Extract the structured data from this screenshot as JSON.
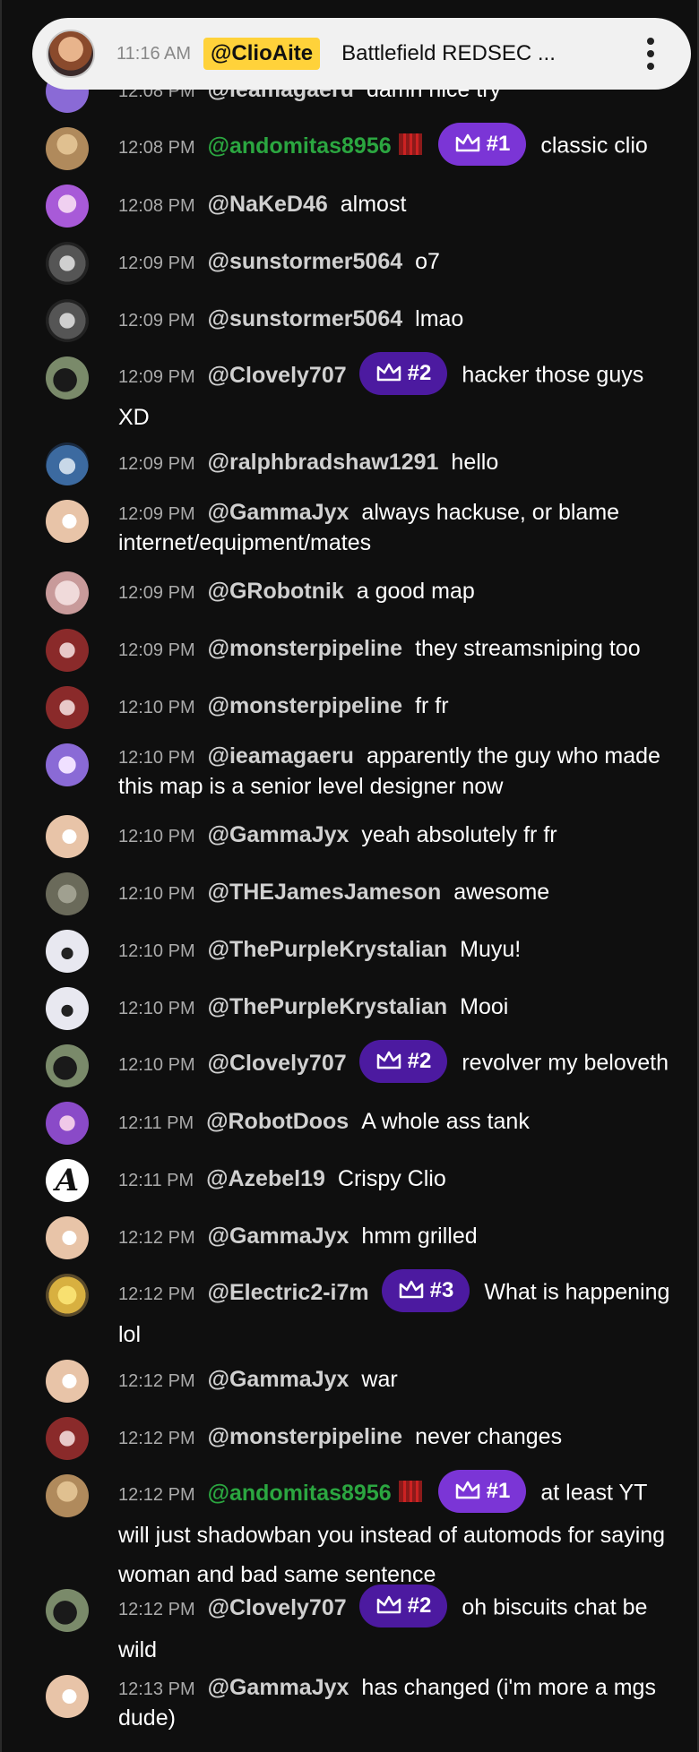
{
  "pinned": {
    "time": "11:16 AM",
    "author": "@ClioAite",
    "text": "Battlefield REDSEC ..."
  },
  "colors": {
    "background": "#0f0f0f",
    "member_name": "#2ba640",
    "rank1": "#7b35d6",
    "rank2": "#4c1aa0",
    "pinned_highlight": "#ffd23a"
  },
  "messages": [
    {
      "time": "12:08 PM",
      "author": "@ieamagaeru",
      "text": "damn nice try",
      "avatar": "#8a6ad6"
    },
    {
      "time": "12:08 PM",
      "author": "@andomitas8956",
      "badge": "#1",
      "text": "classic clio",
      "avatar": "#b08a5c"
    },
    {
      "time": "12:08 PM",
      "author": "@NaKeD46",
      "text": "almost",
      "avatar": "#a85ad8"
    },
    {
      "time": "12:09 PM",
      "author": "@sunstormer5064",
      "text": "o7",
      "avatar": "#777777"
    },
    {
      "time": "12:09 PM",
      "author": "@sunstormer5064",
      "text": "lmao",
      "avatar": "#777777"
    },
    {
      "time": "12:09 PM",
      "author": "@Clovely707",
      "badge": "#2",
      "text": "hacker those guys XD",
      "avatar": "#3d4a33"
    },
    {
      "time": "12:09 PM",
      "author": "@ralphbradshaw1291",
      "text": "hello",
      "avatar": "#3c6aa0"
    },
    {
      "time": "12:09 PM",
      "author": "@GammaJyx",
      "text": "always hackuse, or blame internet/equipment/mates",
      "avatar": "#e8c4a8"
    },
    {
      "time": "12:09 PM",
      "author": "@GRobotnik",
      "text": "a good map",
      "avatar": "#c89a9a"
    },
    {
      "time": "12:09 PM",
      "author": "@monsterpipeline",
      "text": "they streamsniping too",
      "avatar": "#8a2a2a"
    },
    {
      "time": "12:10 PM",
      "author": "@monsterpipeline",
      "text": "fr fr",
      "avatar": "#8a2a2a"
    },
    {
      "time": "12:10 PM",
      "author": "@ieamagaeru",
      "text": "apparently the guy who made this map is a senior level designer now",
      "avatar": "#8a6ad6"
    },
    {
      "time": "12:10 PM",
      "author": "@GammaJyx",
      "text": "yeah absolutely fr fr",
      "avatar": "#e8c4a8"
    },
    {
      "time": "12:10 PM",
      "author": "@THEJamesJameson",
      "text": "awesome",
      "avatar": "#6a6a5a"
    },
    {
      "time": "12:10 PM",
      "author": "@ThePurpleKrystalian",
      "text": "Muyu!",
      "avatar": "#e8e8f0"
    },
    {
      "time": "12:10 PM",
      "author": "@ThePurpleKrystalian",
      "text": "Mooi",
      "avatar": "#e8e8f0"
    },
    {
      "time": "12:10 PM",
      "author": "@Clovely707",
      "badge": "#2",
      "text": "revolver my beloveth",
      "avatar": "#3d4a33"
    },
    {
      "time": "12:11 PM",
      "author": "@RobotDoos",
      "text": "A whole ass tank",
      "avatar": "#8a4ac8"
    },
    {
      "time": "12:11 PM",
      "author": "@Azebel19",
      "text": "Crispy Clio",
      "avatar": "#ffffff"
    },
    {
      "time": "12:12 PM",
      "author": "@GammaJyx",
      "text": "hmm grilled",
      "avatar": "#e8c4a8"
    },
    {
      "time": "12:12 PM",
      "author": "@Electric2-i7m",
      "badge": "#3",
      "text": "What is happening lol",
      "avatar": "#d8b040"
    },
    {
      "time": "12:12 PM",
      "author": "@GammaJyx",
      "text": "war",
      "avatar": "#e8c4a8"
    },
    {
      "time": "12:12 PM",
      "author": "@monsterpipeline",
      "text": "never changes",
      "avatar": "#8a2a2a"
    },
    {
      "time": "12:12 PM",
      "author": "@andomitas8956",
      "badge": "#1",
      "text": "at least YT will just shadowban you instead of automods for saying woman and bad same sentence",
      "avatar": "#b08a5c"
    },
    {
      "time": "12:12 PM",
      "author": "@Clovely707",
      "badge": "#2",
      "text": "oh biscuits chat be wild",
      "avatar": "#3d4a33"
    },
    {
      "time": "12:13 PM",
      "author": "@GammaJyx",
      "text": "has changed (i'm more a mgs dude)",
      "avatar": "#e8c4a8"
    }
  ]
}
